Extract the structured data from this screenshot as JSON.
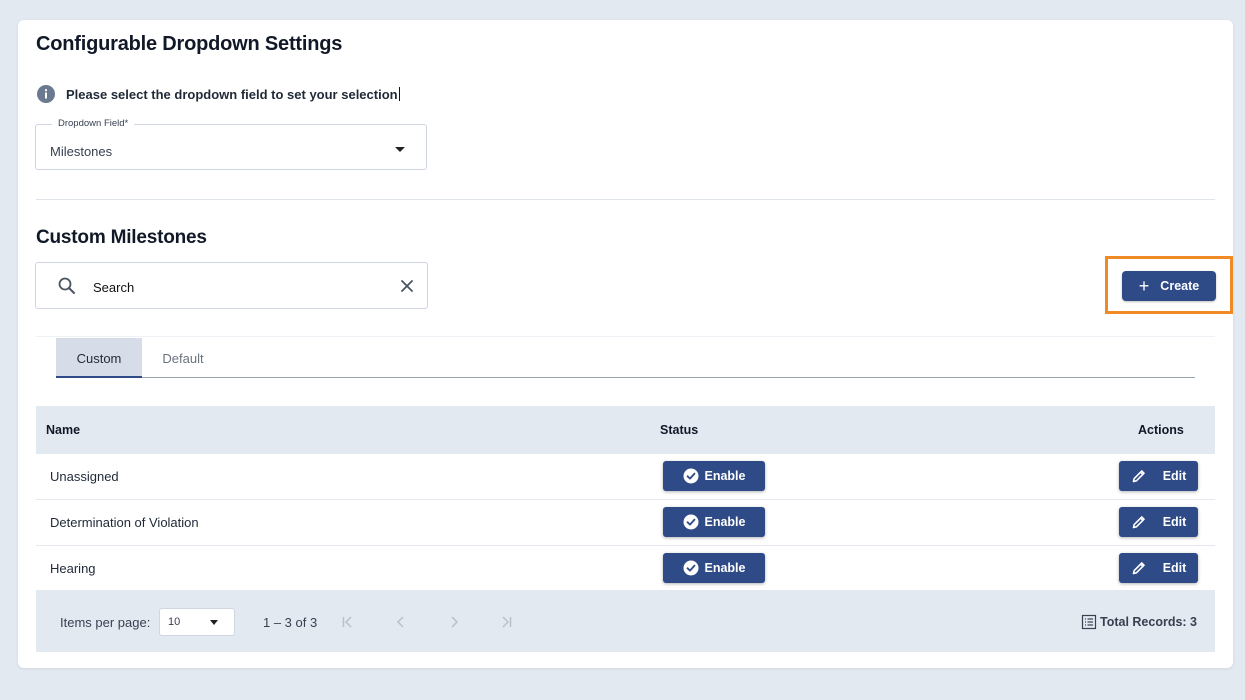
{
  "page": {
    "title": "Configurable Dropdown Settings",
    "info_text": "Please select the dropdown field to set your selection"
  },
  "dropdown": {
    "label": "Dropdown Field*",
    "value": "Milestones"
  },
  "section": {
    "title": "Custom Milestones"
  },
  "search": {
    "placeholder": "Search"
  },
  "toolbar": {
    "create_label": "Create"
  },
  "tabs": [
    {
      "label": "Custom",
      "active": true
    },
    {
      "label": "Default",
      "active": false
    }
  ],
  "table": {
    "headers": {
      "name": "Name",
      "status": "Status",
      "actions": "Actions"
    },
    "rows": [
      {
        "name": "Unassigned",
        "status": "Enable",
        "action": "Edit"
      },
      {
        "name": "Determination of Violation",
        "status": "Enable",
        "action": "Edit"
      },
      {
        "name": "Hearing",
        "status": "Enable",
        "action": "Edit"
      }
    ]
  },
  "paginator": {
    "items_per_page_label": "Items per page:",
    "page_size": "10",
    "range_label": "1 – 3 of 3",
    "total_records": "Total Records: 3"
  },
  "colors": {
    "primary": "#2e4a87",
    "background": "#e3e9f1",
    "highlight": "#f08a24"
  }
}
